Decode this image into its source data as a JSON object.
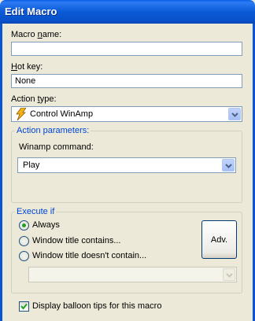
{
  "window": {
    "title": "Edit Macro"
  },
  "macro_name": {
    "label": "Macro name:",
    "value": ""
  },
  "hot_key": {
    "label": "Hot key:",
    "value": "None"
  },
  "action_type": {
    "label": "Action type:",
    "value": "Control WinAmp",
    "icon": "winamp-lightning-icon"
  },
  "action_parameters": {
    "legend": "Action parameters:",
    "command_label": "Winamp command:",
    "command_value": "Play"
  },
  "execute_if": {
    "legend": "Execute if",
    "options": [
      {
        "label": "Always",
        "selected": true
      },
      {
        "label": "Window title contains...",
        "selected": false
      },
      {
        "label": "Window title doesn't contain...",
        "selected": false
      }
    ],
    "adv_button": "Adv.",
    "window_select_value": ""
  },
  "balloon_tips": {
    "label": "Display balloon tips for this macro",
    "checked": true
  }
}
